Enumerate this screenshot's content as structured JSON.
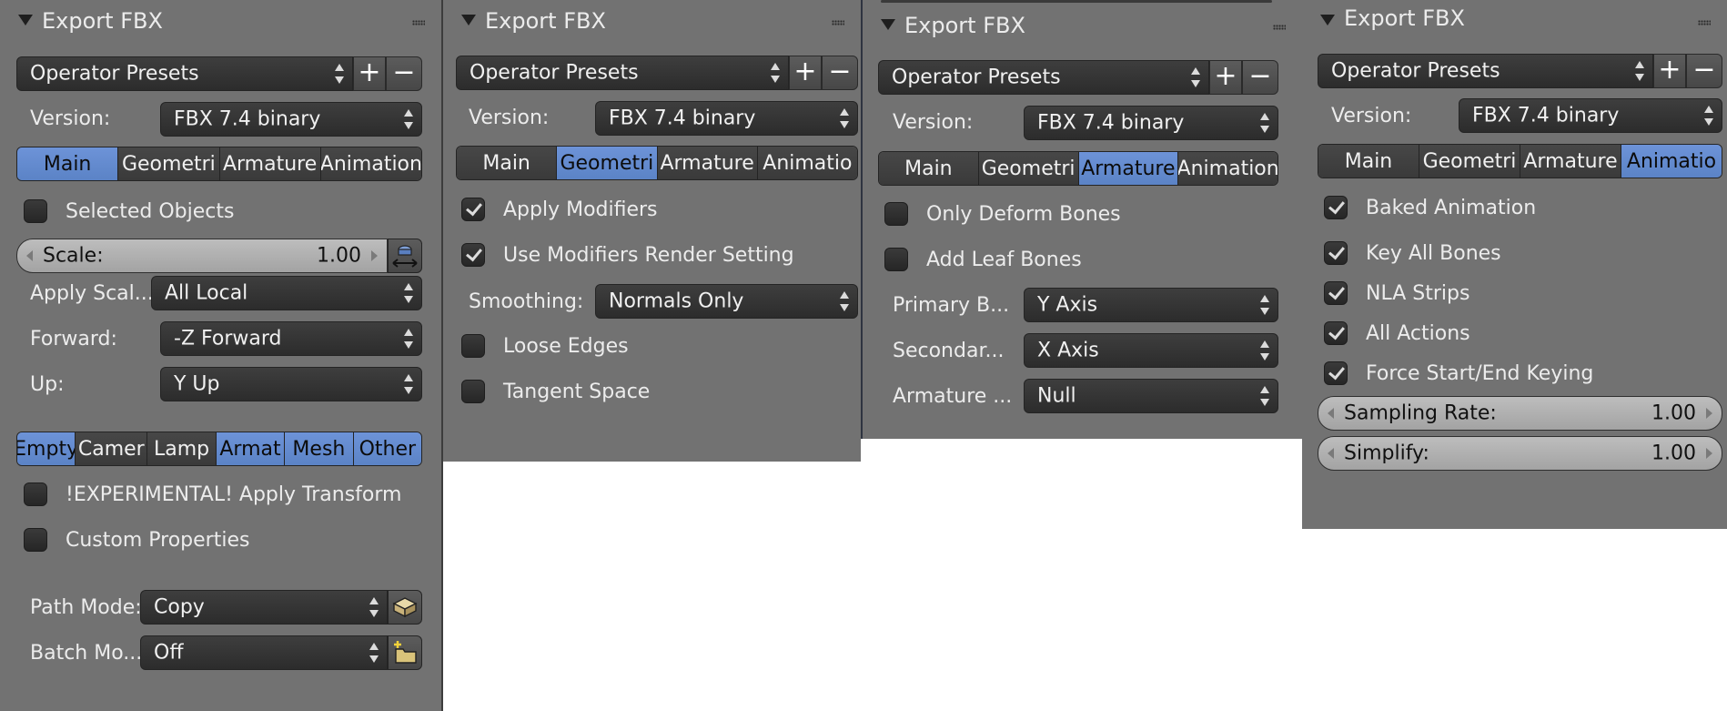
{
  "panels": [
    {
      "header": "Export FBX",
      "presets": "Operator Presets",
      "version_label": "Version:",
      "version_value": "FBX 7.4 binary",
      "tabs": [
        "Main",
        "Geometri",
        "Armature",
        "Animation"
      ],
      "active_tab": 0,
      "selected_objects": "Selected Objects",
      "scale_label": "Scale:",
      "scale_value": "1.00",
      "apply_scale_label": "Apply Scal...",
      "apply_scale_value": "All Local",
      "forward_label": "Forward:",
      "forward_value": "-Z Forward",
      "up_label": "Up:",
      "up_value": "Y Up",
      "types": [
        {
          "label": "Empty",
          "on": true
        },
        {
          "label": "Camer",
          "on": false
        },
        {
          "label": "Lamp",
          "on": false
        },
        {
          "label": "Armat",
          "on": true
        },
        {
          "label": "Mesh",
          "on": true
        },
        {
          "label": "Other",
          "on": true
        }
      ],
      "experimental": "!EXPERIMENTAL! Apply Transform",
      "custom_props": "Custom Properties",
      "path_mode_label": "Path Mode:",
      "path_mode_value": "Copy",
      "batch_label": "Batch Mo...",
      "batch_value": "Off"
    },
    {
      "header": "Export FBX",
      "presets": "Operator Presets",
      "version_label": "Version:",
      "version_value": "FBX 7.4 binary",
      "tabs": [
        "Main",
        "Geometri",
        "Armature",
        "Animatio"
      ],
      "active_tab": 1,
      "apply_modifiers": "Apply Modifiers",
      "use_mod_render": "Use Modifiers Render Setting",
      "smoothing_label": "Smoothing:",
      "smoothing_value": "Normals Only",
      "loose_edges": "Loose Edges",
      "tangent_space": "Tangent Space"
    },
    {
      "header": "Export FBX",
      "presets": "Operator Presets",
      "version_label": "Version:",
      "version_value": "FBX 7.4 binary",
      "tabs": [
        "Main",
        "Geometri",
        "Armature",
        "Animation"
      ],
      "active_tab": 2,
      "only_deform": "Only Deform Bones",
      "add_leaf": "Add Leaf Bones",
      "primary_label": "Primary B...",
      "primary_value": "Y Axis",
      "secondary_label": "Secondar...",
      "secondary_value": "X Axis",
      "armature_label": "Armature ...",
      "armature_value": "Null"
    },
    {
      "header": "Export FBX",
      "presets": "Operator Presets",
      "version_label": "Version:",
      "version_value": "FBX 7.4 binary",
      "tabs": [
        "Main",
        "Geometri",
        "Armature",
        "Animatio"
      ],
      "active_tab": 3,
      "baked": "Baked Animation",
      "key_all": "Key All Bones",
      "nla": "NLA Strips",
      "all_actions": "All Actions",
      "force_keying": "Force Start/End Keying",
      "sampling_label": "Sampling Rate:",
      "sampling_value": "1.00",
      "simplify_label": "Simplify:",
      "simplify_value": "1.00"
    }
  ],
  "colors": {
    "panel_bg": "#727272",
    "active_blue": "#5b83c6",
    "widget_dark": "#3a3a3a"
  }
}
